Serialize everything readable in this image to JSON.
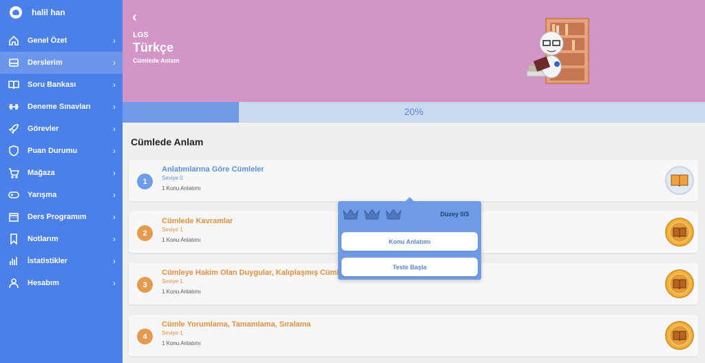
{
  "user": {
    "name": "halil han"
  },
  "sidebar": {
    "items": [
      {
        "label": "Genel Özet",
        "icon": "home-icon"
      },
      {
        "label": "Derslerim",
        "icon": "drive-icon"
      },
      {
        "label": "Soru Bankası",
        "icon": "book-icon"
      },
      {
        "label": "Deneme Sınavları",
        "icon": "dumbbell-icon"
      },
      {
        "label": "Görevler",
        "icon": "rocket-icon"
      },
      {
        "label": "Puan Durumu",
        "icon": "shield-icon"
      },
      {
        "label": "Mağaza",
        "icon": "cart-icon"
      },
      {
        "label": "Yarışma",
        "icon": "gamepad-icon"
      },
      {
        "label": "Ders Programım",
        "icon": "calendar-icon"
      },
      {
        "label": "Notlarım",
        "icon": "bookmark-icon"
      },
      {
        "label": "İstatistikler",
        "icon": "bar-chart-icon"
      },
      {
        "label": "Hesabım",
        "icon": "user-icon"
      }
    ],
    "active_index": 1
  },
  "header": {
    "exam": "LGS",
    "subject": "Türkçe",
    "topic": "Cümlede Anlam",
    "background": "#d394c8"
  },
  "progress": {
    "value": 0.2,
    "label": "20%"
  },
  "section": {
    "title": "Cümlede Anlam"
  },
  "lessons": [
    {
      "num": "1",
      "title": "Anlatımlarına Göre Cümleler",
      "level": "Seviye 0",
      "sub": "1 Konu Anlatımı",
      "color": "#6c9de9",
      "badge": "blue"
    },
    {
      "num": "2",
      "title": "Cümlede Kavramlar",
      "level": "Seviye 1",
      "sub": "1 Konu Anlatımı",
      "color": "#e49a4f",
      "badge": "gold"
    },
    {
      "num": "3",
      "title": "Cümleye Hakim Olan Duygular, Kalıplaşmış Cümle",
      "level": "Seviye 1",
      "sub": "1 Konu Anlatımı",
      "color": "#e49a4f",
      "badge": "gold"
    },
    {
      "num": "4",
      "title": "Cümle Yorumlama, Tamamlama, Sıralama",
      "level": "Seviye 1",
      "sub": "1 Konu Anlatımı",
      "color": "#e49a4f",
      "badge": "gold"
    }
  ],
  "popup": {
    "level_label": "Düzey 0/3",
    "crowns": 3,
    "buttons": {
      "lecture": "Konu Anlatımı",
      "start_test": "Teste Başla"
    }
  },
  "colors": {
    "sidebar": "#4a80e8",
    "accent_blue": "#6c9de9",
    "accent_orange": "#e49a4f"
  }
}
